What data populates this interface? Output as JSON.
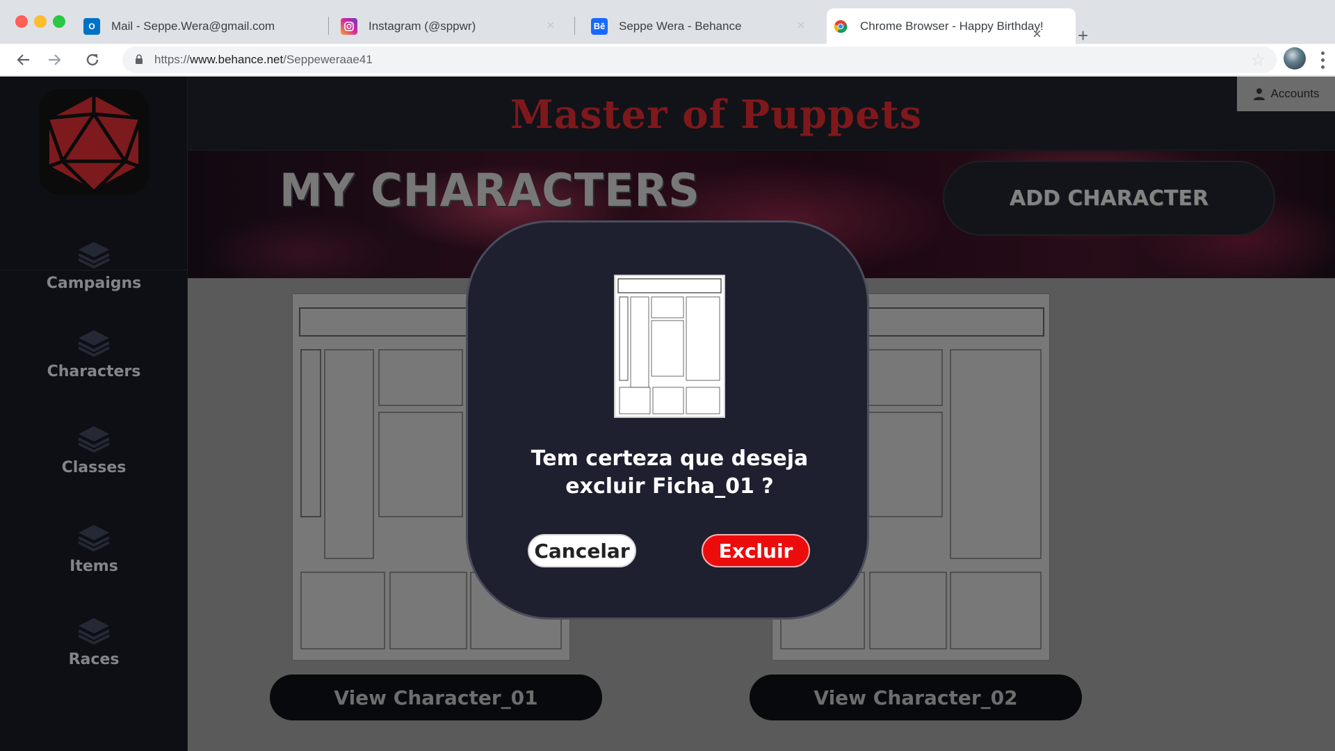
{
  "browser": {
    "tabs": [
      {
        "title": "Mail - Seppe.Wera@gmail.com",
        "icon": "outlook-icon",
        "color": "#0072c6"
      },
      {
        "title": "Instagram (@sppwr)",
        "icon": "instagram-icon",
        "color": "#d6249f"
      },
      {
        "title": "Seppe Wera - Behance",
        "icon": "behance-icon",
        "color": "#1769ff"
      },
      {
        "title": "Chrome Browser - Happy Birthday!",
        "icon": "chrome-icon",
        "color": "#4285f4"
      }
    ],
    "close_glyph": "×",
    "new_tab_glyph": "+",
    "url_scheme": "https://",
    "url_host": "www.behance.net",
    "url_path": "/Seppeweraae41"
  },
  "app": {
    "title": "Master of Puppets",
    "accounts_label": "Accounts",
    "sidebar": {
      "items": [
        {
          "label": "Campaigns"
        },
        {
          "label": "Characters"
        },
        {
          "label": "Classes"
        },
        {
          "label": "Items"
        },
        {
          "label": "Races"
        }
      ]
    },
    "banner": {
      "title": "MY CHARACTERS",
      "add_label": "ADD CHARACTER"
    },
    "characters": [
      {
        "button": "View Character_01"
      },
      {
        "button": "View Character_02"
      }
    ],
    "modal": {
      "line1": "Tem certeza que deseja",
      "line2": "excluir Ficha_01 ?",
      "cancel_label": "Cancelar",
      "delete_label": "Excluir"
    },
    "colors": {
      "title": "#c4252a",
      "delete": "#ec0c0c",
      "modal_bg": "#1e2030"
    }
  }
}
